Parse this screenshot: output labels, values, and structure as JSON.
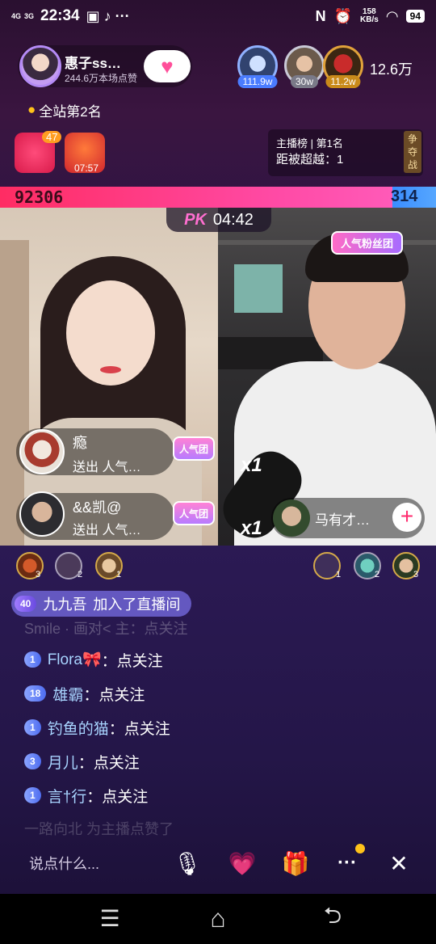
{
  "status_bar": {
    "signal1": "4G",
    "signal2": "3G",
    "time": "22:34",
    "speed_value": "158",
    "speed_unit": "KB/s",
    "battery": "94"
  },
  "host": {
    "name": "惠子ss…",
    "likes": "244.6万本场点赞"
  },
  "top_viewers": [
    {
      "badge": "111.9w",
      "color": "#4a7cff"
    },
    {
      "badge": "30w",
      "color": "#7a7a88"
    },
    {
      "badge": "11.2w",
      "color": "#c98a1a"
    }
  ],
  "online_count": "12.6万",
  "site_rank": "全站第2名",
  "gift_badge": "47",
  "gift_timer": "07:57",
  "anchor_rank": {
    "label": "主播榜",
    "position": "第1名",
    "gap_label": "距被超越：",
    "gap_value": "1",
    "fight": "争夺战"
  },
  "pk": {
    "score_left": "92306",
    "score_right": "314",
    "timer": "04:42",
    "logo": "PK",
    "score_share_left": 0.9966
  },
  "fan_tag": "人气粉丝团",
  "gifters_left": [
    {
      "name": "瘾",
      "action": "送出 人气…",
      "tag": "人气团"
    },
    {
      "name": "&&凯@",
      "action": "送出 人气…",
      "tag": "人气团"
    }
  ],
  "x1_label": "x1",
  "gifter_right": {
    "name": "马有才…"
  },
  "rank_left": [
    "3",
    "2",
    "1"
  ],
  "rank_right": [
    "1",
    "2",
    "3"
  ],
  "join": {
    "level": "40",
    "name": "九九吾",
    "text": "加入了直播间"
  },
  "faded_top": "Smile · 画对< 主：点关注",
  "chat": [
    {
      "level": "1",
      "name": "Flora🎀",
      "msg": "：点关注"
    },
    {
      "level": "18",
      "name": "雄霸",
      "msg": "：点关注"
    },
    {
      "level": "1",
      "name": "钓鱼的猫",
      "msg": "：点关注"
    },
    {
      "level": "3",
      "name": "月儿",
      "msg": "：点关注"
    },
    {
      "level": "1",
      "name": "言†行",
      "msg": "：点关注"
    }
  ],
  "faded_bottom": "一路向北 为主播点赞了",
  "input_placeholder": "说点什么...",
  "icons": {
    "mic": "🎙",
    "like": "💗",
    "gift": "🎁",
    "more": "···",
    "close": "✕",
    "menu": "☰",
    "home": "⌂",
    "back": "⮌"
  }
}
